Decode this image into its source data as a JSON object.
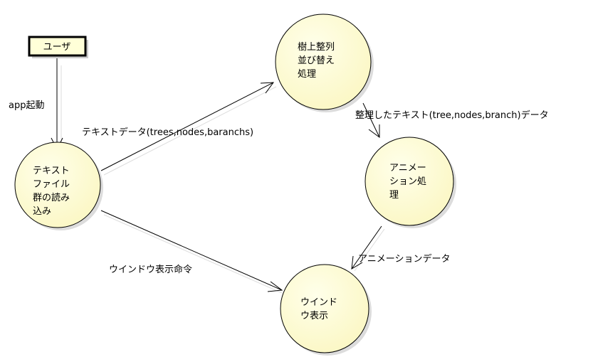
{
  "actor": {
    "label": "ユーザ"
  },
  "processes": {
    "read_files": {
      "lines": [
        "テキスト",
        "ファイル",
        "群の読み",
        "込み"
      ]
    },
    "sort_tree": {
      "lines": [
        "樹上整列",
        "並び替え",
        "処理"
      ]
    },
    "animation": {
      "lines": [
        "アニメー",
        "ション処",
        "理"
      ]
    },
    "window_display": {
      "lines": [
        "ウインド",
        "ウ表示"
      ]
    }
  },
  "flows": {
    "app_start": {
      "label": "app起動"
    },
    "text_data": {
      "label": "テキストデータ(trees,nodes,baranchs)"
    },
    "sorted_text": {
      "label": "整理したテキスト(tree,nodes,branch)データ"
    },
    "window_command": {
      "label": "ウインドウ表示命令"
    },
    "animation_data": {
      "label": "アニメーションデータ"
    }
  },
  "colors": {
    "process_fill": "#ffffd4",
    "process_shadow": "#d8d8d8",
    "stroke": "#000000",
    "actor_fill": "#ffffd8"
  }
}
